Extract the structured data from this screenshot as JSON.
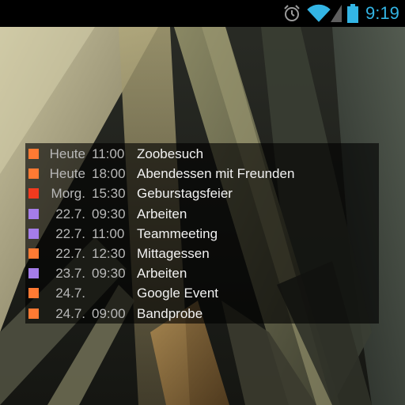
{
  "status_bar": {
    "time": "9:19",
    "icons": [
      "alarm-icon",
      "wifi-icon",
      "signal-icon",
      "battery-icon"
    ],
    "accent_color": "#33b5e5"
  },
  "agenda": {
    "events": [
      {
        "day": "Heute",
        "time": "11:00",
        "title": "Zoobesuch",
        "color": "#ff7a33"
      },
      {
        "day": "Heute",
        "time": "18:00",
        "title": "Abendessen mit Freunden",
        "color": "#ff7a33"
      },
      {
        "day": "Morg.",
        "time": "15:30",
        "title": "Geburstagsfeier",
        "color": "#f23a1e"
      },
      {
        "day": "22.7.",
        "time": "09:30",
        "title": "Arbeiten",
        "color": "#a57de8"
      },
      {
        "day": "22.7.",
        "time": "11:00",
        "title": "Teammeeting",
        "color": "#a57de8"
      },
      {
        "day": "22.7.",
        "time": "12:30",
        "title": "Mittagessen",
        "color": "#ff7a33"
      },
      {
        "day": "23.7.",
        "time": "09:30",
        "title": "Arbeiten",
        "color": "#a57de8"
      },
      {
        "day": "24.7.",
        "time": "",
        "title": "Google Event",
        "color": "#ff7a33"
      },
      {
        "day": "24.7.",
        "time": "09:00",
        "title": "Bandprobe",
        "color": "#ff7a33"
      }
    ]
  }
}
